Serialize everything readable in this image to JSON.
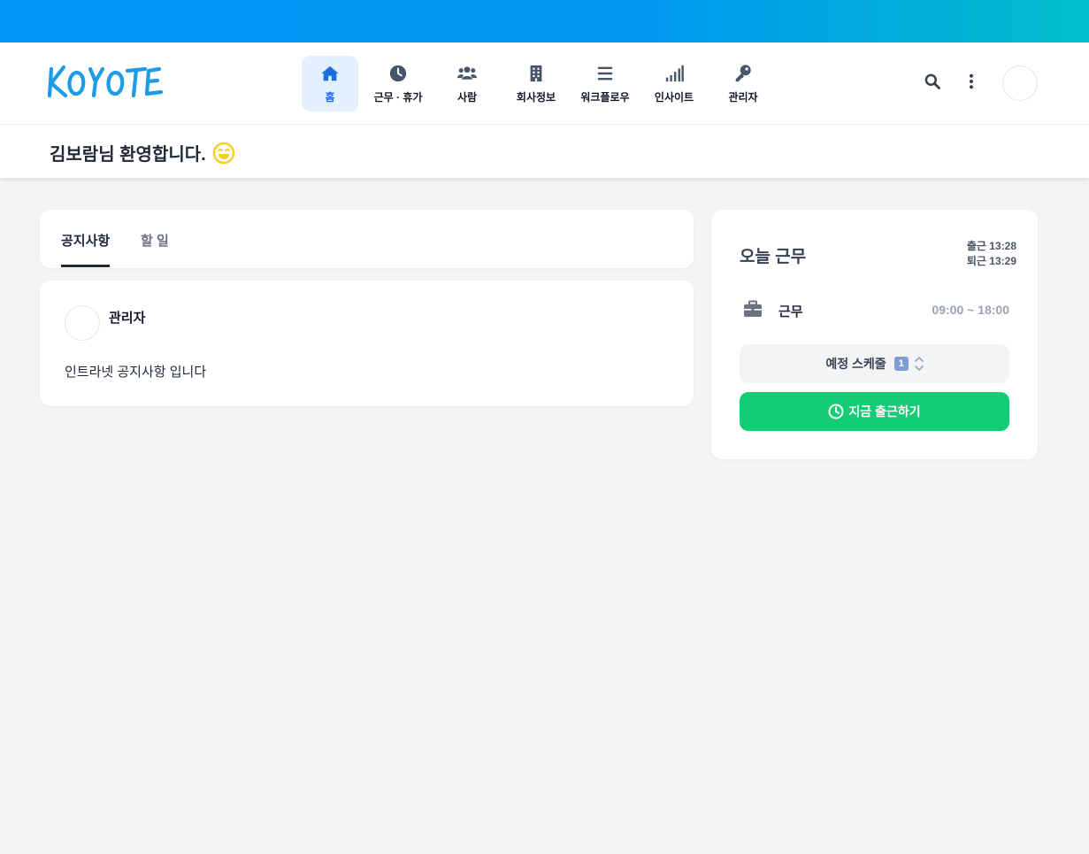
{
  "app": {
    "logo_text": "KOYOTE",
    "accent_color": "#1d6fe0",
    "brand_gradient": [
      "#0195f6",
      "#02bdca"
    ]
  },
  "nav": {
    "items": [
      {
        "label": "홈",
        "icon": "home-icon",
        "active": true
      },
      {
        "label": "근무 · 휴가",
        "icon": "clock-icon",
        "active": false
      },
      {
        "label": "사람",
        "icon": "people-icon",
        "active": false
      },
      {
        "label": "회사정보",
        "icon": "building-icon",
        "active": false
      },
      {
        "label": "워크플로우",
        "icon": "list-icon",
        "active": false
      },
      {
        "label": "인사이트",
        "icon": "signal-icon",
        "active": false
      },
      {
        "label": "관리자",
        "icon": "key-icon",
        "active": false
      }
    ]
  },
  "header_actions": {
    "search_icon": "search-icon",
    "more_icon": "more-vertical-icon"
  },
  "welcome": {
    "text": "김보람님 환영합니다.",
    "emoji_icon": "wink-smile-icon"
  },
  "tabs": [
    {
      "label": "공지사항",
      "active": true
    },
    {
      "label": "할 일",
      "active": false
    }
  ],
  "notice": {
    "author": "관리자",
    "body": "인트라넷 공지사항 입니다"
  },
  "today_work": {
    "title": "오늘 근무",
    "check_in": "출근 13:28",
    "check_out": "퇴근 13:29",
    "work_label": "근무",
    "work_hours": "09:00 ~ 18:00",
    "schedule_label": "예정 스케줄",
    "schedule_count": "1",
    "checkin_button": "지금 출근하기",
    "checkin_color": "#13cc73"
  }
}
